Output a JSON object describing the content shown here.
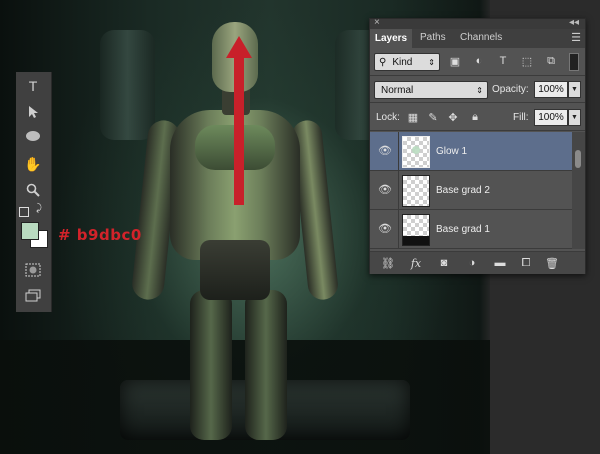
{
  "annotation": {
    "hex_code": "# b9dbc0"
  },
  "colors": {
    "foreground": "#b9dbc0",
    "background": "#ffffff",
    "arrow": "#c8202a",
    "selected_layer": "#5d6e8c"
  },
  "panel": {
    "tabs": [
      {
        "label": "Layers",
        "active": true
      },
      {
        "label": "Paths"
      },
      {
        "label": "Channels"
      }
    ],
    "filter": {
      "kind_label": "Kind"
    },
    "blend_mode": "Normal",
    "opacity_label": "Opacity:",
    "opacity_value": "100%",
    "lock_label": "Lock:",
    "fill_label": "Fill:",
    "fill_value": "100%",
    "layers": [
      {
        "name": "Glow 1",
        "selected": true
      },
      {
        "name": "Base grad 2",
        "selected": false
      },
      {
        "name": "Base grad 1",
        "selected": false
      }
    ],
    "footer_fx": "fx"
  },
  "icons": {
    "tools": [
      "type-icon",
      "path-selection-icon",
      "ellipse-icon",
      "hand-icon",
      "zoom-icon",
      "quick-mask-icon",
      "screen-mode-icon"
    ],
    "filter": [
      "image-filter-icon",
      "adjustment-filter-icon",
      "type-filter-icon",
      "shape-filter-icon",
      "smart-object-filter-icon"
    ],
    "lock": [
      "lock-transparent-icon",
      "lock-image-icon",
      "lock-position-icon",
      "lock-all-icon"
    ],
    "footer": [
      "link-icon",
      "fx-icon",
      "mask-icon",
      "adjustment-icon",
      "folder-icon",
      "new-layer-icon",
      "trash-icon"
    ]
  }
}
